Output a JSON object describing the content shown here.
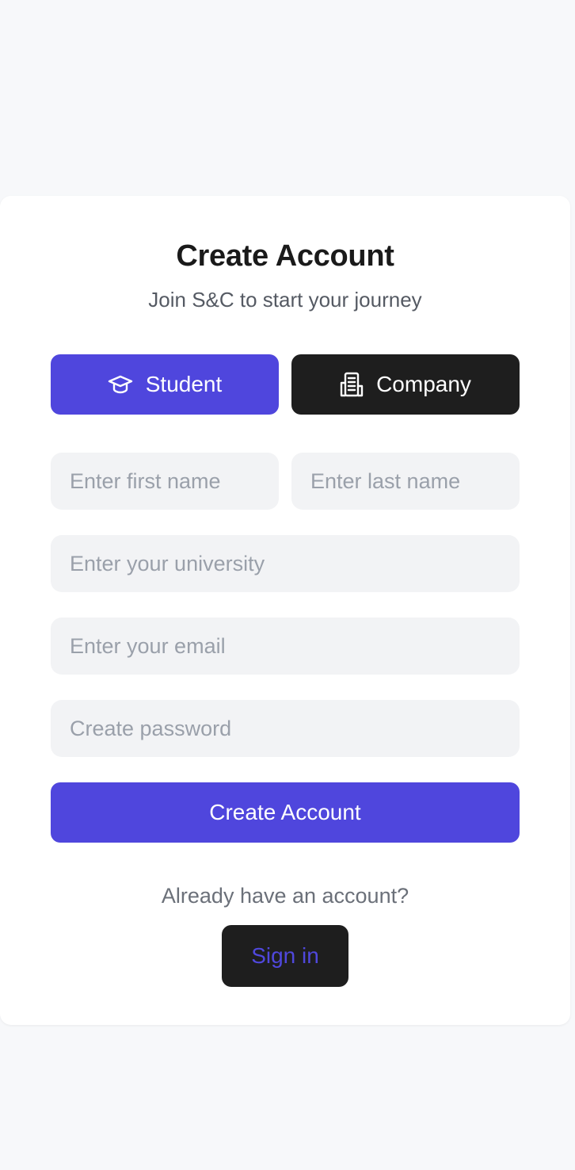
{
  "header": {
    "title": "Create Account",
    "subtitle": "Join S&C to start your journey"
  },
  "roles": [
    {
      "label": "Student",
      "icon": "graduation-cap-icon",
      "selected": true
    },
    {
      "label": "Company",
      "icon": "building-icon",
      "selected": false
    }
  ],
  "form": {
    "first_name": {
      "value": "",
      "placeholder": "Enter first name"
    },
    "last_name": {
      "value": "",
      "placeholder": "Enter last name"
    },
    "university": {
      "value": "",
      "placeholder": "Enter your university"
    },
    "email": {
      "value": "",
      "placeholder": "Enter your email"
    },
    "password": {
      "value": "",
      "placeholder": "Create password"
    },
    "submit_label": "Create Account"
  },
  "footer": {
    "prompt": "Already have an account?",
    "signin_label": "Sign in"
  },
  "colors": {
    "background": "#f7f8fa",
    "primary": "#4f46dd",
    "dark": "#1e1e1e",
    "field_bg": "#f2f3f5",
    "placeholder": "#9aa0aa"
  }
}
